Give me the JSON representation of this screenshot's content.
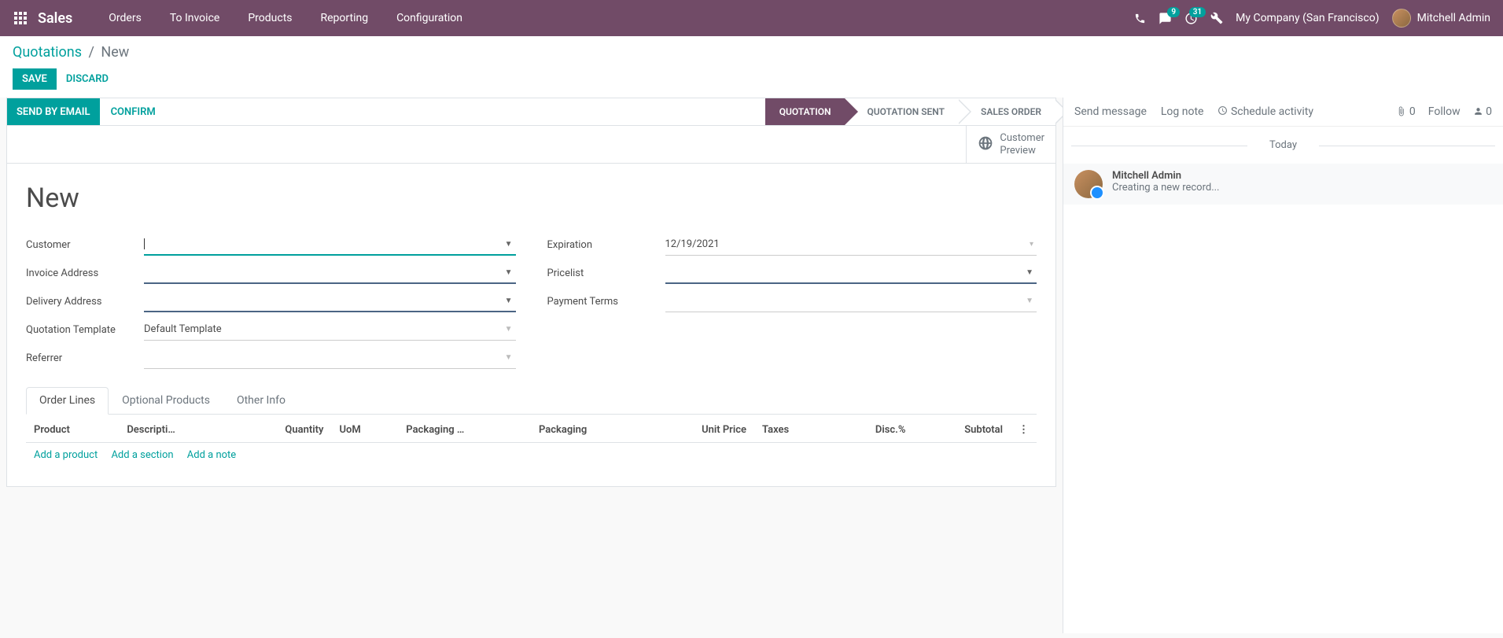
{
  "topnav": {
    "brand": "Sales",
    "menu": [
      "Orders",
      "To Invoice",
      "Products",
      "Reporting",
      "Configuration"
    ],
    "msg_badge": "9",
    "activity_badge": "31",
    "company": "My Company (San Francisco)",
    "user": "Mitchell Admin"
  },
  "breadcrumb": {
    "root": "Quotations",
    "current": "New"
  },
  "buttons": {
    "save": "SAVE",
    "discard": "DISCARD"
  },
  "status_actions": {
    "send": "SEND BY EMAIL",
    "confirm": "CONFIRM"
  },
  "status_steps": [
    "QUOTATION",
    "QUOTATION SENT",
    "SALES ORDER"
  ],
  "sheet": {
    "customer_preview": "Customer\nPreview",
    "title": "New",
    "left_fields": {
      "customer": "Customer",
      "invoice_address": "Invoice Address",
      "delivery_address": "Delivery Address",
      "quotation_template": "Quotation Template",
      "quotation_template_val": "Default Template",
      "referrer": "Referrer"
    },
    "right_fields": {
      "expiration": "Expiration",
      "expiration_val": "12/19/2021",
      "pricelist": "Pricelist",
      "payment_terms": "Payment Terms"
    }
  },
  "tabs": [
    "Order Lines",
    "Optional Products",
    "Other Info"
  ],
  "columns": [
    "Product",
    "Descripti…",
    "Quantity",
    "UoM",
    "Packaging …",
    "Packaging",
    "Unit Price",
    "Taxes",
    "Disc.%",
    "Subtotal"
  ],
  "addlinks": [
    "Add a product",
    "Add a section",
    "Add a note"
  ],
  "chatter": {
    "send_message": "Send message",
    "log_note": "Log note",
    "schedule": "Schedule activity",
    "attach_count": "0",
    "follow": "Follow",
    "follower_count": "0",
    "today": "Today",
    "msg_author": "Mitchell Admin",
    "msg_text": "Creating a new record..."
  }
}
